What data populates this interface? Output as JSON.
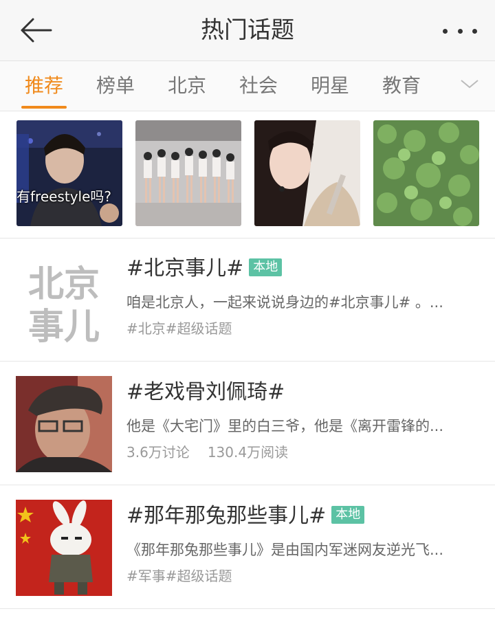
{
  "header": {
    "title": "热门话题",
    "back_icon": "back-arrow-icon",
    "more_icon": "more-dots-icon"
  },
  "tabs": [
    {
      "label": "推荐",
      "active": true
    },
    {
      "label": "榜单",
      "active": false
    },
    {
      "label": "北京",
      "active": false
    },
    {
      "label": "社会",
      "active": false
    },
    {
      "label": "明星",
      "active": false
    },
    {
      "label": "教育",
      "active": false
    }
  ],
  "tabs_expand_icon": "chevron-down-icon",
  "thumbs": [
    {
      "caption": "有freestyle吗?"
    },
    {
      "caption": ""
    },
    {
      "caption": ""
    },
    {
      "caption": ""
    }
  ],
  "topics": [
    {
      "logo_text": [
        "北京",
        "事儿"
      ],
      "title": "#北京事儿#",
      "badge": "本地",
      "desc": "咱是北京人，一起来说说身边的#北京事儿# 。...",
      "meta": [
        "#北京#超级话题"
      ]
    },
    {
      "title": "#老戏骨刘佩琦#",
      "badge": "",
      "desc": "他是《大宅门》里的白三爷，他是《离开雷锋的...",
      "meta": [
        "3.6万讨论",
        "130.4万阅读"
      ]
    },
    {
      "title": "#那年那兔那些事儿#",
      "badge": "本地",
      "desc": "《那年那兔那些事儿》是由国内军迷网友逆光飞...",
      "meta": [
        "#军事#超级话题"
      ]
    }
  ],
  "colors": {
    "accent": "#f08a1c",
    "badge": "#5cc2a4"
  }
}
